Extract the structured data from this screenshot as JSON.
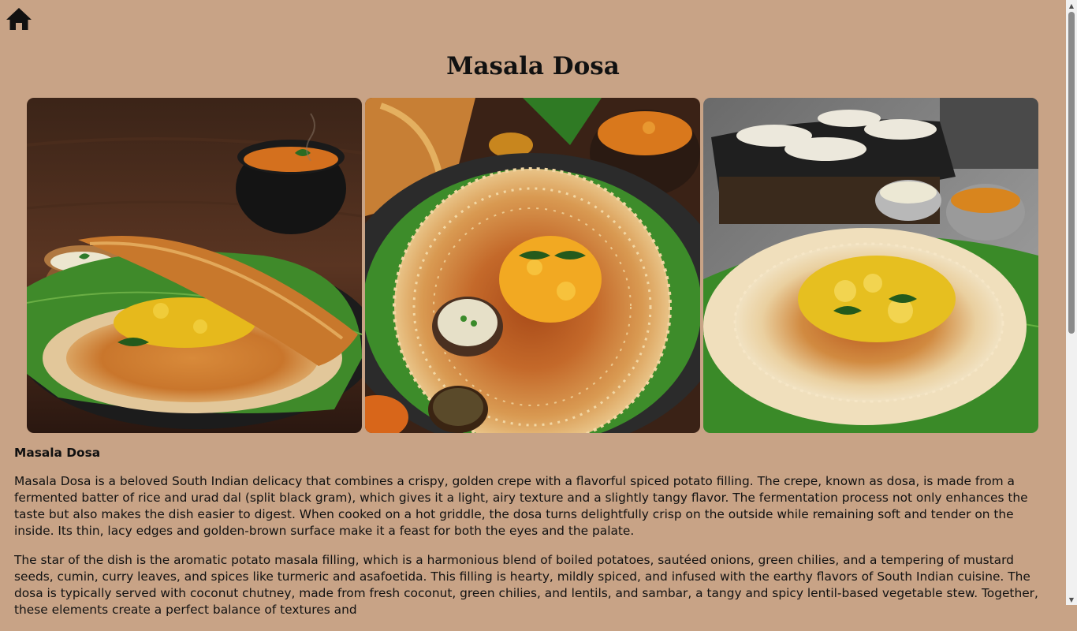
{
  "page": {
    "title": "Masala Dosa"
  },
  "nav": {
    "home_icon": "home-icon"
  },
  "gallery": {
    "images": [
      {
        "name": "dosa-photo-1",
        "subject": "folded masala dosa with coconut chutney and sambar on banana leaf"
      },
      {
        "name": "dosa-photo-2",
        "subject": "round lacy dosa topped with potato masala and chutney bowl"
      },
      {
        "name": "dosa-photo-3",
        "subject": "dosa with potato filling on banana leaf near griddle"
      }
    ]
  },
  "article": {
    "heading": "Masala Dosa",
    "paragraphs": [
      "Masala Dosa is a beloved South Indian delicacy that combines a crispy, golden crepe with a flavorful spiced potato filling. The crepe, known as dosa, is made from a fermented batter of rice and urad dal (split black gram), which gives it a light, airy texture and a slightly tangy flavor. The fermentation process not only enhances the taste but also makes the dish easier to digest. When cooked on a hot griddle, the dosa turns delightfully crisp on the outside while remaining soft and tender on the inside. Its thin, lacy edges and golden-brown surface make it a feast for both the eyes and the palate.",
      "The star of the dish is the aromatic potato masala filling, which is a harmonious blend of boiled potatoes, sautéed onions, green chilies, and a tempering of mustard seeds, cumin, curry leaves, and spices like turmeric and asafoetida. This filling is hearty, mildly spiced, and infused with the earthy flavors of South Indian cuisine. The dosa is typically served with coconut chutney, made from fresh coconut, green chilies, and lentils, and sambar, a tangy and spicy lentil-based vegetable stew. Together, these elements create a perfect balance of textures and"
    ]
  },
  "colors": {
    "background": "#c8a386",
    "text": "#111111"
  }
}
